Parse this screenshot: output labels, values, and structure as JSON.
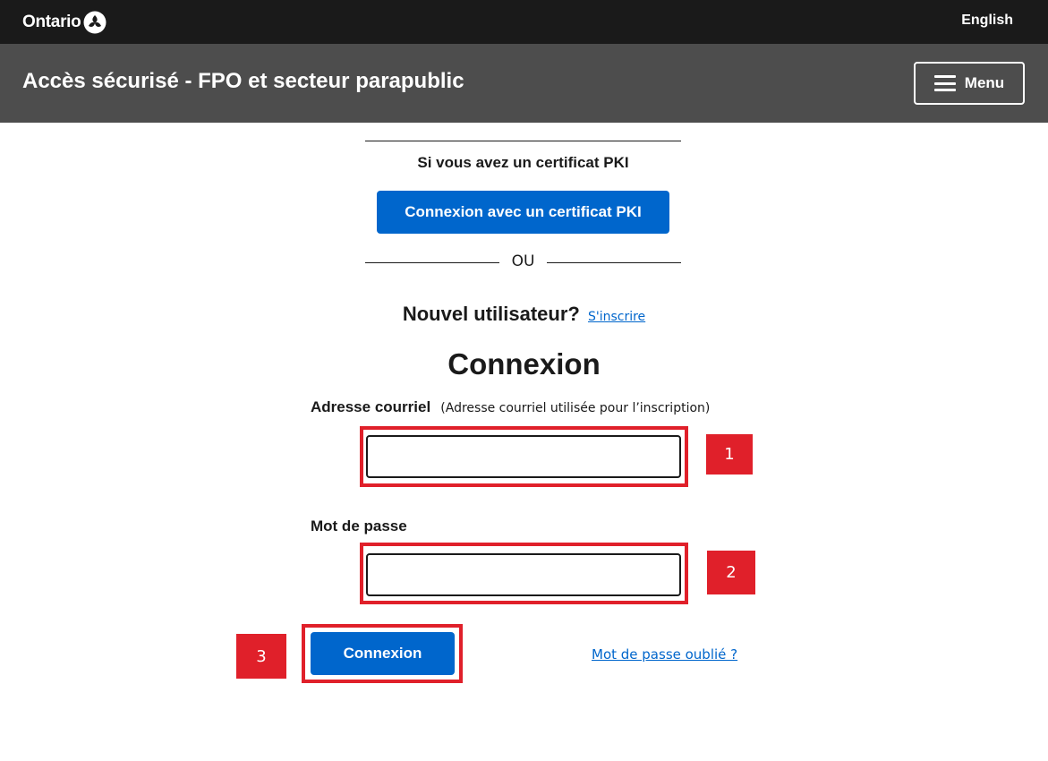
{
  "header": {
    "logo_text": "Ontario",
    "language_link": "English"
  },
  "app_bar": {
    "title": "Accès sécurisé - FPO et secteur parapublic",
    "menu_label": "Menu"
  },
  "pki": {
    "heading": "Si vous avez un certificat PKI",
    "button_label": "Connexion avec un certificat PKI"
  },
  "divider": {
    "or_text": "OU"
  },
  "new_user": {
    "label": "Nouvel utilisateur?",
    "register_link": "S'inscrire"
  },
  "signin": {
    "heading": "Connexion",
    "email_label": "Adresse courriel",
    "email_hint": "(Adresse courriel utilisée pour l’inscription)",
    "email_value": "",
    "password_label": "Mot de passe",
    "password_value": "",
    "button_label": "Connexion",
    "forgot_link": "Mot de passe oublié ?"
  },
  "annotations": {
    "badge_1": "1",
    "badge_2": "2",
    "badge_3": "3",
    "highlight_color": "#e0202a"
  },
  "colors": {
    "top_bar": "#1a1a1a",
    "app_bar": "#4d4d4d",
    "primary_button": "#0066cc",
    "link": "#0066cc"
  }
}
